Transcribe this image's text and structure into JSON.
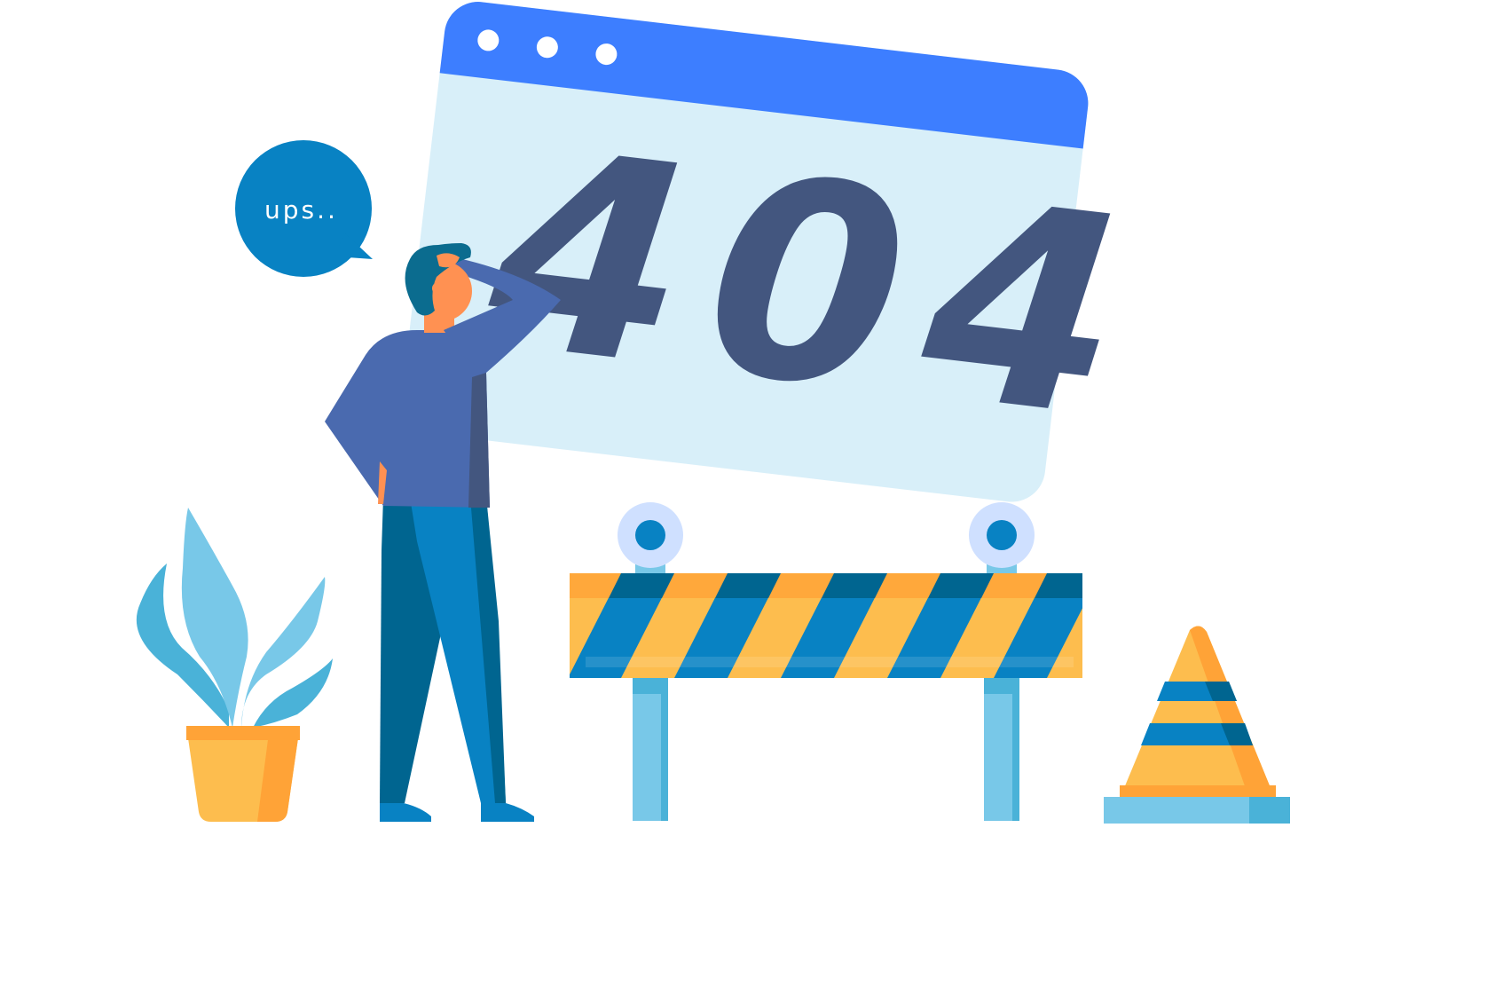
{
  "browser_window": {
    "error_code": "404",
    "dots": 3
  },
  "speech_bubble": {
    "text": "ups.."
  },
  "colors": {
    "window_bar": "#3d7eff",
    "window_body": "#d8eff9",
    "code_text": "#43567f",
    "bubble": "#0882c3",
    "shirt": "#4a6aaf",
    "pants_dark": "#006590",
    "pants_light": "#0882c3",
    "skin": "#ff9152",
    "hair": "#0b6c8f",
    "stripe_orange": "#fdbd4e",
    "stripe_blue": "#0882c3",
    "leg_light": "#78c8e8",
    "pot": "#fdbd4e",
    "leaf": "#78c8e8"
  },
  "icons": [
    "window-dot-icon",
    "warning-light-icon",
    "traffic-cone-icon",
    "plant-icon"
  ]
}
